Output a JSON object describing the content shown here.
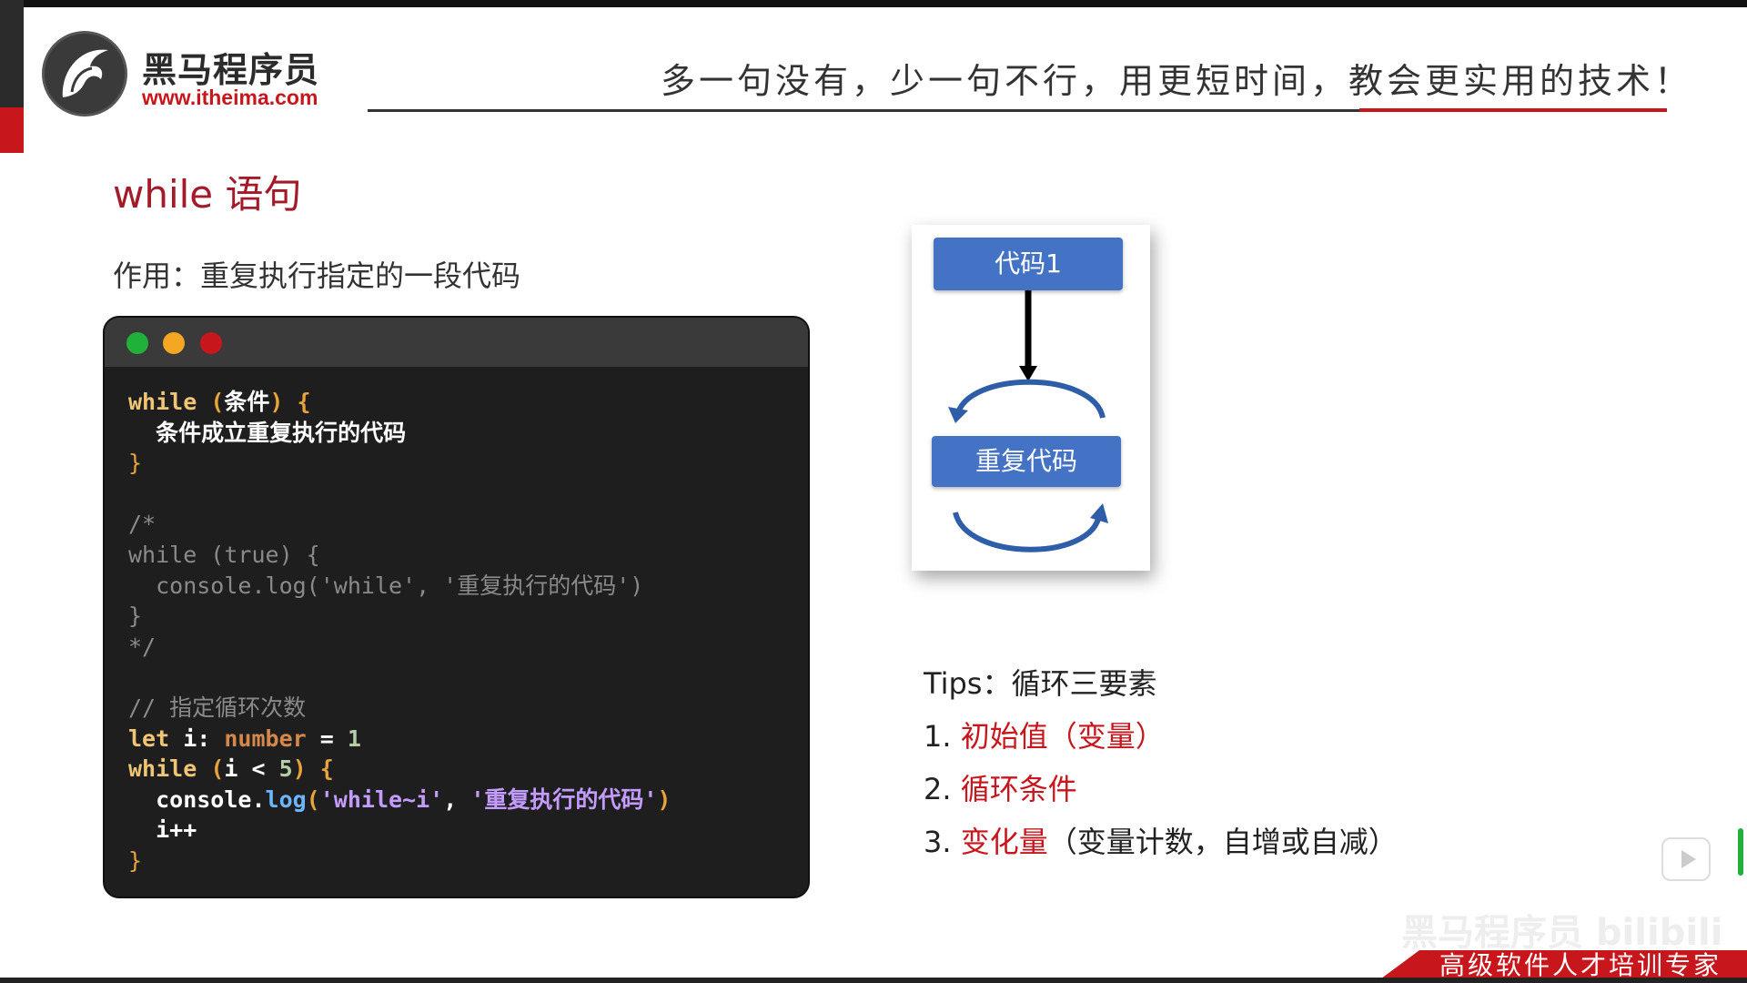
{
  "header": {
    "logo_name": "黑马程序员",
    "logo_url": "www.itheima.com",
    "slogan": "多一句没有，少一句不行，用更短时间，教会更实用的技术！"
  },
  "slide": {
    "title": "while 语句",
    "purpose": "作用：重复执行指定的一段代码"
  },
  "code": {
    "window_dots": [
      "green",
      "yellow",
      "red"
    ],
    "lines": [
      "while (条件) {",
      "  条件成立重复执行的代码",
      "}",
      "",
      "/*",
      "while (true) {",
      "  console.log('while', '重复执行的代码')",
      "}",
      "*/",
      "",
      "// 指定循环次数",
      "let i: number = 1",
      "while (i < 5) {",
      "  console.log('while~i', '重复执行的代码')",
      "  i++",
      "}"
    ]
  },
  "flowchart": {
    "box1": "代码1",
    "box2": "重复代码",
    "arrow_color": "#4472c4",
    "box_color": "#4472c4"
  },
  "tips": {
    "heading": "Tips：循环三要素",
    "item1_num": "1. ",
    "item1_red": "初始值（变量）",
    "item2_num": "2. ",
    "item2_red": "循环条件",
    "item3_num": "3. ",
    "item3_red": "变化量",
    "item3_rest": "（变量计数，自增或自减）"
  },
  "footer": {
    "tagline": "高级软件人才培训专家",
    "watermark": "黑马程序员 bilibili"
  },
  "colors": {
    "accent_red": "#c8161d",
    "title_red": "#a31b2a"
  }
}
